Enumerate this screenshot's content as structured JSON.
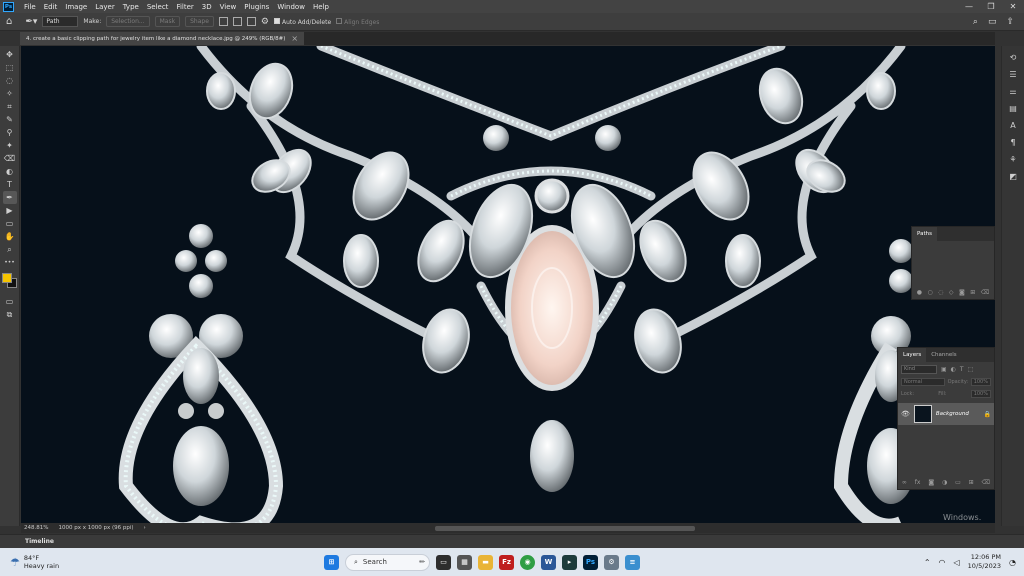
{
  "menubar": {
    "app_badge": "Ps",
    "items": [
      "File",
      "Edit",
      "Image",
      "Layer",
      "Type",
      "Select",
      "Filter",
      "3D",
      "View",
      "Plugins",
      "Window",
      "Help"
    ],
    "minimize": "—",
    "maximize": "❐",
    "close": "✕"
  },
  "options": {
    "mode_value": "Path",
    "make_label": "Make:",
    "selection_btn": "Selection...",
    "mask_btn": "Mask",
    "shape_btn": "Shape",
    "auto_add_delete": "Auto Add/Delete",
    "align_edges": "Align Edges"
  },
  "document": {
    "tab_title": "4. create a basic clipping path for jewelry item like a diamond necklace.jpg @ 249% (RGB/8#)",
    "close": "×"
  },
  "tools": [
    "✥",
    "⬚",
    "◌",
    "✧",
    "⌗",
    "✎",
    "⚲",
    "✦",
    "⌫",
    "◐",
    "✒",
    "T",
    "▶",
    "▭",
    "✋",
    "⌕",
    "•••"
  ],
  "colors": {
    "foreground": "#f5c400",
    "background": "#111111",
    "canvas_bg": "#06101a"
  },
  "paths_panel": {
    "tab": "Paths"
  },
  "layers_panel": {
    "tabs": [
      "Layers",
      "Channels"
    ],
    "kind_placeholder": "Kind",
    "blend_mode": "Normal",
    "opacity_label": "Opacity:",
    "opacity_value": "100%",
    "fill_label": "Fill:",
    "fill_value": "100%",
    "lock_label": "Lock:",
    "layer_name": "Background"
  },
  "status": {
    "zoom": "248.81%",
    "doc_size": "1000 px x 1000 px (96 ppi)",
    "watermark": "Windows."
  },
  "timeline": {
    "label": "Timeline"
  },
  "taskbar": {
    "temperature": "84°F",
    "weather": "Heavy rain",
    "search": "Search",
    "time": "12:06 PM",
    "date": "10/5/2023"
  }
}
